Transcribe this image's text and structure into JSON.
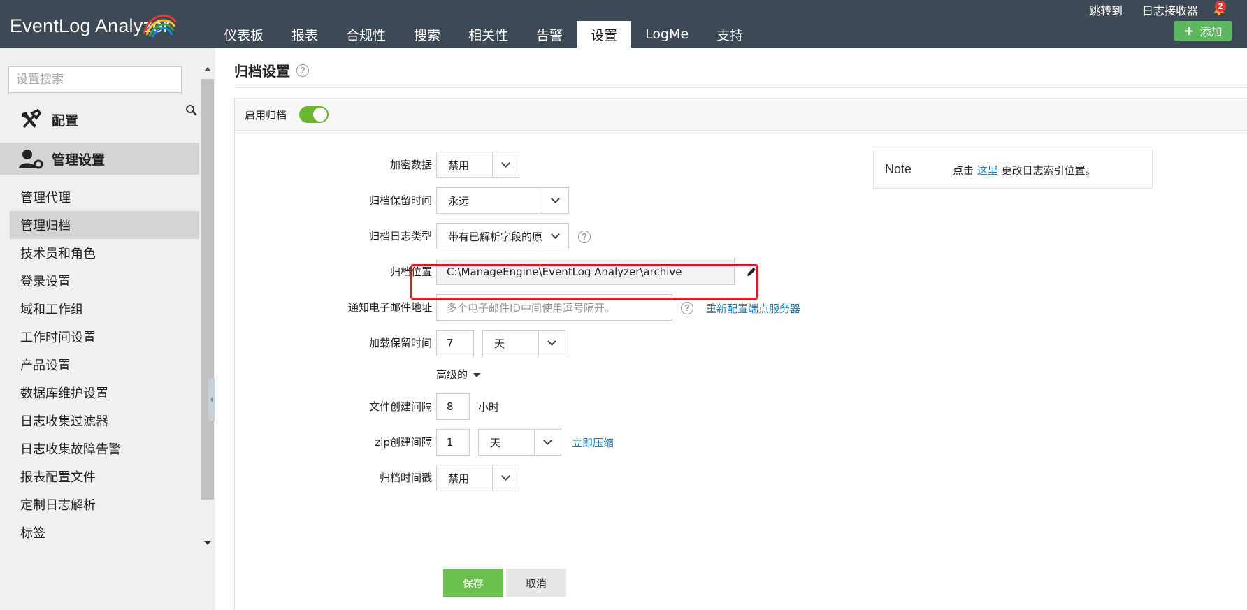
{
  "app": {
    "logo_text": "EventLog Analyzer",
    "nav_tabs": [
      {
        "label": "仪表板"
      },
      {
        "label": "报表"
      },
      {
        "label": "合规性"
      },
      {
        "label": "搜索"
      },
      {
        "label": "相关性"
      },
      {
        "label": "告警"
      },
      {
        "label": "设置"
      },
      {
        "label": "LogMe"
      },
      {
        "label": "支持"
      }
    ],
    "active_tab": "设置",
    "top_links": {
      "jump": "跳转到",
      "log_receiver": "日志接收器"
    },
    "notification_count": "2",
    "add_button": "添加",
    "accent_color": "#5cb85c"
  },
  "sidebar": {
    "search_placeholder": "设置搜索",
    "sections": {
      "config": "配置",
      "admin": "管理设置"
    },
    "items": [
      {
        "label": "管理代理"
      },
      {
        "label": "管理归档"
      },
      {
        "label": "技术员和角色"
      },
      {
        "label": "登录设置"
      },
      {
        "label": "域和工作组"
      },
      {
        "label": "工作时间设置"
      },
      {
        "label": "产品设置"
      },
      {
        "label": "数据库维护设置"
      },
      {
        "label": "日志收集过滤器"
      },
      {
        "label": "日志收集故障告警"
      },
      {
        "label": "报表配置文件"
      },
      {
        "label": "定制日志解析"
      },
      {
        "label": "标签"
      }
    ],
    "active_item": "管理归档"
  },
  "page": {
    "title": "归档设置",
    "enable_label": "启用归档",
    "enabled": true,
    "form": {
      "encrypt": {
        "label": "加密数据",
        "value": "禁用"
      },
      "retention": {
        "label": "归档保留时间",
        "value": "永远"
      },
      "log_type": {
        "label": "归档日志类型",
        "value": "带有已解析字段的原始"
      },
      "location": {
        "label": "归档位置",
        "value": "C:\\ManageEngine\\EventLog Analyzer\\archive"
      },
      "email": {
        "label": "通知电子邮件地址",
        "placeholder": "多个电子邮件ID中间使用逗号隔开。",
        "link": "重新配置端点服务器"
      },
      "load_retention": {
        "label": "加载保留时间",
        "value": "7",
        "unit": "天"
      },
      "advanced": "高级的",
      "file_interval": {
        "label": "文件创建间隔",
        "value": "8",
        "unit": "小时"
      },
      "zip_interval": {
        "label": "zip创建间隔",
        "value": "1",
        "unit": "天",
        "link": "立即压缩"
      },
      "timestamp": {
        "label": "归档时间戳",
        "value": "禁用"
      }
    },
    "note": {
      "title": "Note",
      "prefix": "点击",
      "link": "这里",
      "suffix": "更改日志索引位置。"
    },
    "buttons": {
      "save": "保存",
      "cancel": "取消"
    }
  }
}
